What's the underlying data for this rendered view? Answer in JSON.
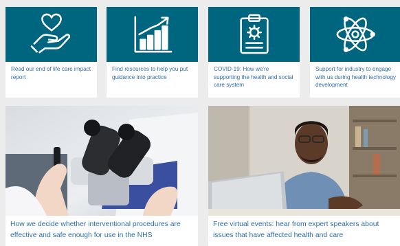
{
  "cards": [
    {
      "label": "Read our end of life care impact report",
      "icon": "heart-hand-icon"
    },
    {
      "label": "Find resources to help you put guidance into practice",
      "icon": "growth-chart-icon"
    },
    {
      "label": "COVID-19: How we're supporting the health and social care system",
      "icon": "clipboard-virus-icon"
    },
    {
      "label": "Support for industry to engage with us during health technology development",
      "icon": "atom-icon"
    }
  ],
  "features": [
    {
      "label": "How we decide whether interventional procedures are effective and safe enough for use in the NHS",
      "image": "microscope-photo"
    },
    {
      "label": "Free virtual events: hear from expert speakers about issues that have affected health and care",
      "image": "man-at-laptop-photo"
    }
  ],
  "colors": {
    "panel": "#006680",
    "link": "#2f6fa8",
    "background": "#ececec"
  }
}
